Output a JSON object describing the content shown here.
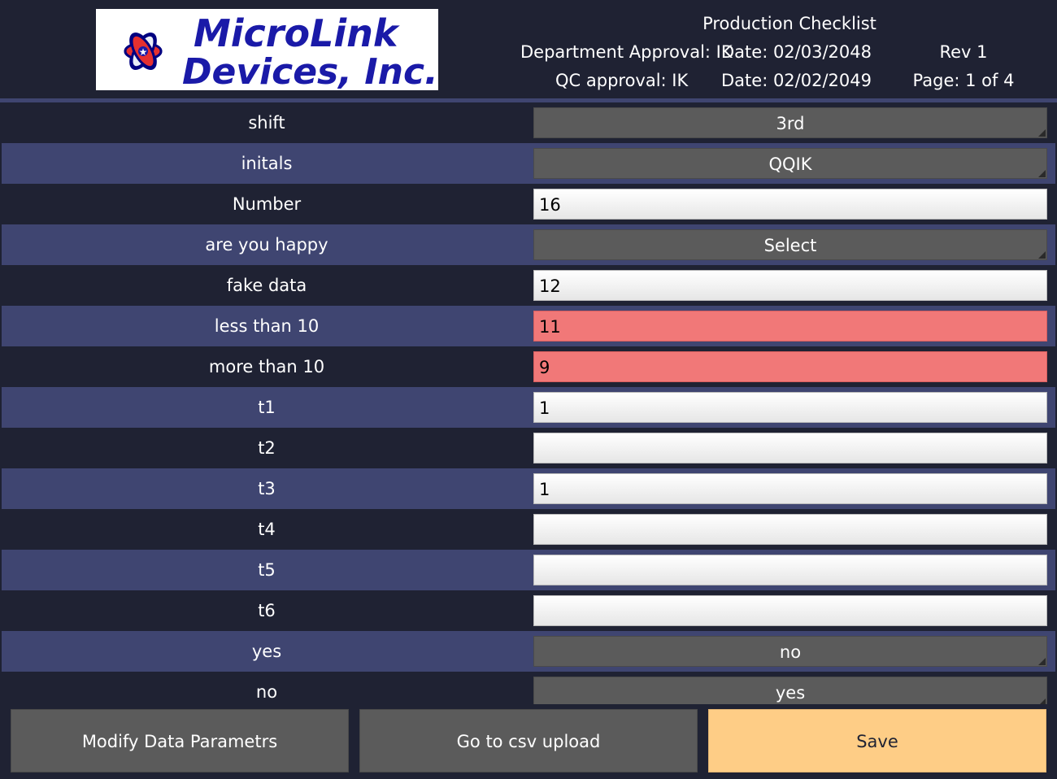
{
  "header": {
    "logo_text_line1": "MicroLink",
    "logo_text_line2": "Devices, Inc.",
    "title": "Production Checklist",
    "department_approval": "Department Approval: IK",
    "date1": "Date: 02/03/2048",
    "rev": "Rev 1",
    "qc_approval": "QC approval: IK",
    "date2": "Date: 02/02/2049",
    "page": "Page: 1 of 4"
  },
  "fields": [
    {
      "label": "shift",
      "type": "dropdown",
      "value": "3rd"
    },
    {
      "label": "initals",
      "type": "dropdown",
      "value": "QQIK"
    },
    {
      "label": "Number",
      "type": "input",
      "value": "16"
    },
    {
      "label": "are you happy",
      "type": "dropdown",
      "value": "Select"
    },
    {
      "label": "fake data",
      "type": "input",
      "value": "12"
    },
    {
      "label": "less than 10",
      "type": "input",
      "value": "11",
      "state": "error"
    },
    {
      "label": "more than 10",
      "type": "input",
      "value": "9",
      "state": "error"
    },
    {
      "label": "t1",
      "type": "input",
      "value": "1"
    },
    {
      "label": "t2",
      "type": "input",
      "value": ""
    },
    {
      "label": "t3",
      "type": "input",
      "value": "1"
    },
    {
      "label": "t4",
      "type": "input",
      "value": ""
    },
    {
      "label": "t5",
      "type": "input",
      "value": ""
    },
    {
      "label": "t6",
      "type": "input",
      "value": ""
    },
    {
      "label": "yes",
      "type": "dropdown",
      "value": "no"
    },
    {
      "label": "no",
      "type": "dropdown",
      "value": "yes"
    }
  ],
  "footer": {
    "modify_label": "Modify Data Parametrs",
    "csv_label": "Go to csv upload",
    "save_label": "Save"
  },
  "colors": {
    "background": "#1f2233",
    "row_alt": "#3f4571",
    "error": "#f17878",
    "save": "#fecd86",
    "button": "#5b5b5b",
    "logo_text": "#1a1aa8"
  }
}
